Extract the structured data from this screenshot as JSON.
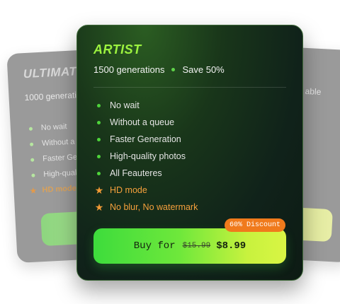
{
  "left_card": {
    "title": "ULTIMATE",
    "subtitle": "1000 generations",
    "features": [
      {
        "label": "No wait",
        "type": "dot"
      },
      {
        "label": "Without a queue",
        "type": "dot"
      },
      {
        "label": "Faster Generation",
        "type": "dot"
      },
      {
        "label": "High-quality photos",
        "type": "dot"
      },
      {
        "label": "HD mode",
        "type": "star"
      }
    ]
  },
  "right_card": {
    "text": "able"
  },
  "main_card": {
    "title": "ARTIST",
    "generations": "1500 generations",
    "save": "Save 50%",
    "features": [
      {
        "label": "No wait",
        "type": "dot"
      },
      {
        "label": "Without a queue",
        "type": "dot"
      },
      {
        "label": "Faster Generation",
        "type": "dot"
      },
      {
        "label": "High-quality photos",
        "type": "dot"
      },
      {
        "label": "All Feauteres",
        "type": "dot"
      },
      {
        "label": "HD mode",
        "type": "star"
      },
      {
        "label": "No blur, No watermark",
        "type": "star"
      }
    ],
    "discount_badge": "60% Discount",
    "buy_label": "Buy for",
    "old_price": "$15.99",
    "new_price": "$8.99"
  },
  "colors": {
    "accent_green": "#9cf23f",
    "highlight_orange": "#f5a03c",
    "badge_orange": "#f07a1c",
    "card_bg": "#10221a"
  }
}
